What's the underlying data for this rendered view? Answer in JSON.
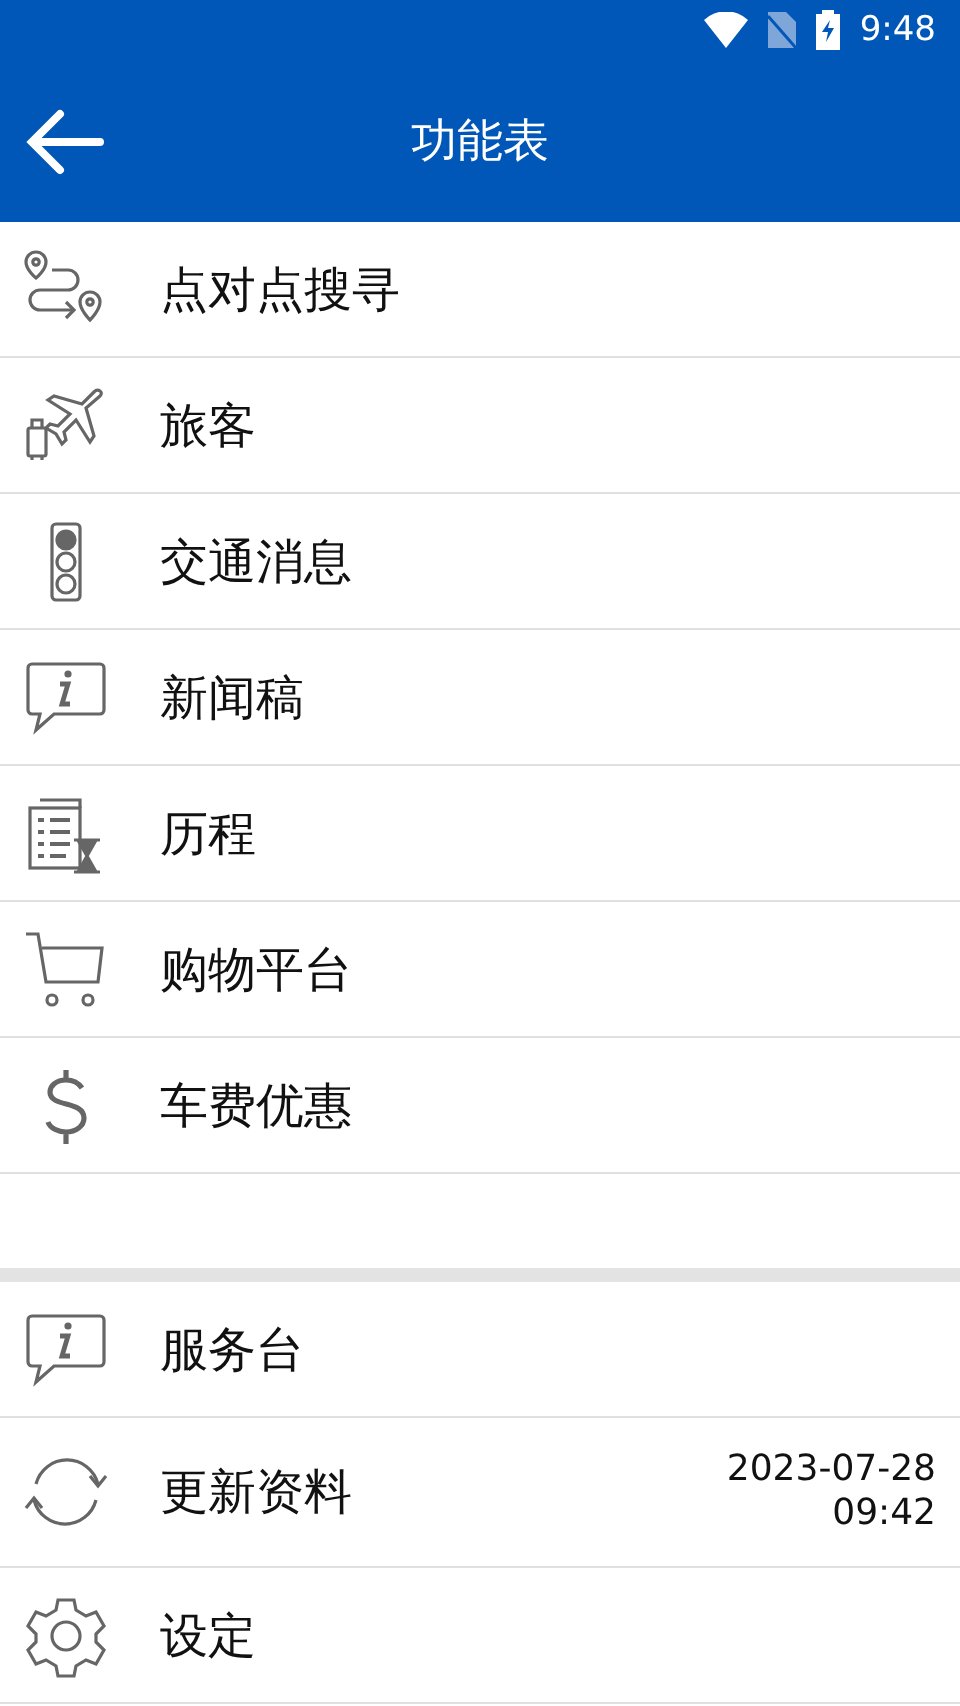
{
  "status_bar": {
    "time": "9:48"
  },
  "header": {
    "title": "功能表"
  },
  "menu_items": [
    {
      "kind": "route",
      "label": "点对点搜寻"
    },
    {
      "kind": "travel",
      "label": "旅客"
    },
    {
      "kind": "traffic",
      "label": "交通消息"
    },
    {
      "kind": "info",
      "label": "新闻稿"
    },
    {
      "kind": "history",
      "label": "历程"
    },
    {
      "kind": "cart",
      "label": "购物平台"
    },
    {
      "kind": "dollar",
      "label": "车费优惠"
    }
  ],
  "extra_items": [
    {
      "kind": "info",
      "label": "服务台"
    },
    {
      "kind": "refresh",
      "label": "更新资料",
      "updated": {
        "date": "2023-07-28",
        "time": "09:42"
      }
    },
    {
      "kind": "gear",
      "label": "设定"
    }
  ]
}
